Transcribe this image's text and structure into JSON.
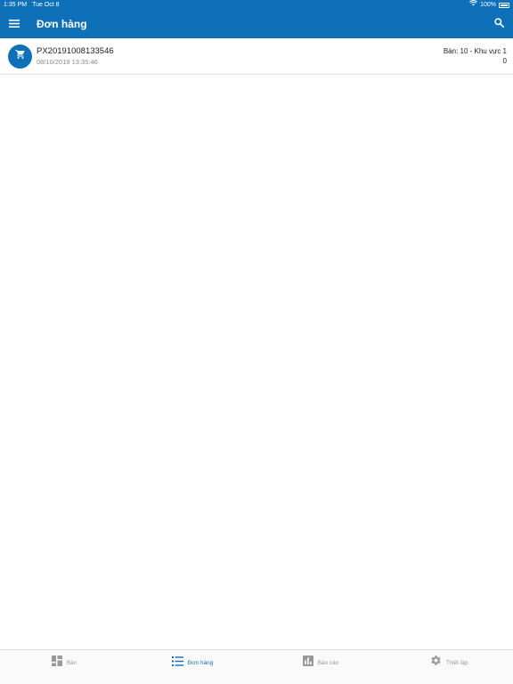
{
  "status_bar": {
    "time": "1:35 PM",
    "date": "Tue Oct 8",
    "battery": "100%"
  },
  "app_bar": {
    "title": "Đơn hàng",
    "menu_icon": "menu-icon",
    "search_icon": "search-icon"
  },
  "orders": [
    {
      "code": "PX20191008133546",
      "time": "08/10/2019 13:35:46",
      "table": "Bàn: 10 - Khu vực 1",
      "amount": "0",
      "icon": "cart-icon"
    }
  ],
  "tabs": [
    {
      "label": "Bàn",
      "icon": "dashboard-icon",
      "active": false
    },
    {
      "label": "Đơn hàng",
      "icon": "list-icon",
      "active": true
    },
    {
      "label": "Báo cáo",
      "icon": "bar-chart-icon",
      "active": false
    },
    {
      "label": "Thiết lập",
      "icon": "gear-icon",
      "active": false
    }
  ],
  "colors": {
    "primary": "#0e70b8",
    "inactive": "#9a9a9a"
  }
}
